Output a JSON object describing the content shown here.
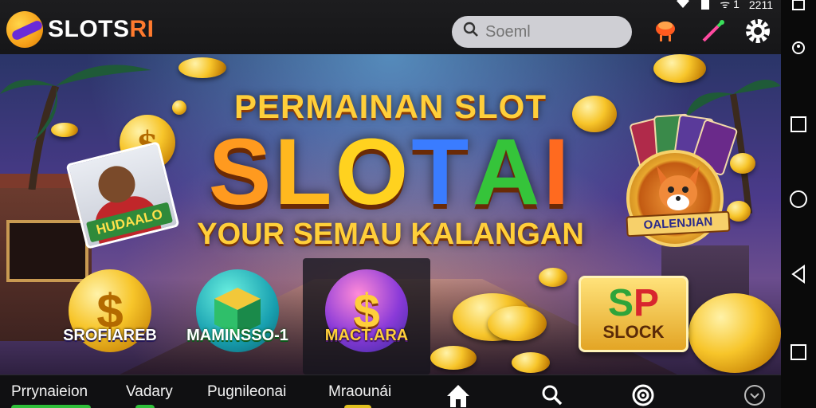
{
  "status_bar": {
    "time": "2211",
    "signal_label": "ᯤ 1"
  },
  "header": {
    "brand_main": "SLOTS",
    "brand_accent": "RI",
    "search": {
      "placeholder": "Soeml",
      "value": ""
    },
    "icons": [
      "basket-icon",
      "magic-wand-icon",
      "settings-gear-icon"
    ]
  },
  "banner": {
    "title_top": "PERMAINAN SLOT",
    "title_big": [
      "S",
      "L",
      "O",
      "T",
      "A",
      "I"
    ],
    "title_big_colors": [
      "#ff9a1f",
      "#ffb81f",
      "#ffd21f",
      "#3a7cff",
      "#35c43a",
      "#ff6a1f"
    ],
    "title_sub": "YOUR SEMAU KALANGAN",
    "player_card_label": "HUDAALO",
    "fox_badge_label": "OALENJIAN",
    "tiles": [
      {
        "label": "SROFIAREB"
      },
      {
        "label": "MAMINSSO-1"
      },
      {
        "label": "MACT.ARA"
      },
      {
        "label": ""
      },
      {
        "label": "SLOCK",
        "logo_s": "S",
        "logo_p": "P"
      }
    ],
    "active_tile_index": 2
  },
  "bottom_nav": {
    "items": [
      "Prrynaieion",
      "Vadary",
      "Pugnileonai",
      "Mraounái"
    ],
    "icons": [
      "home-icon",
      "search-icon",
      "target-icon",
      "chevron-circle-icon"
    ],
    "pill_colors": [
      "#2fbf3a",
      "#2fbf3a",
      "#e0c020"
    ]
  },
  "colors": {
    "accent_orange": "#ff7a2e",
    "gold": "#ffcf3a",
    "header_bg": "#1b1b1d"
  },
  "android_nav_icons": [
    "accessibility-icon",
    "recents-square-icon",
    "home-circle-icon",
    "back-triangle-icon",
    "square-icon"
  ]
}
